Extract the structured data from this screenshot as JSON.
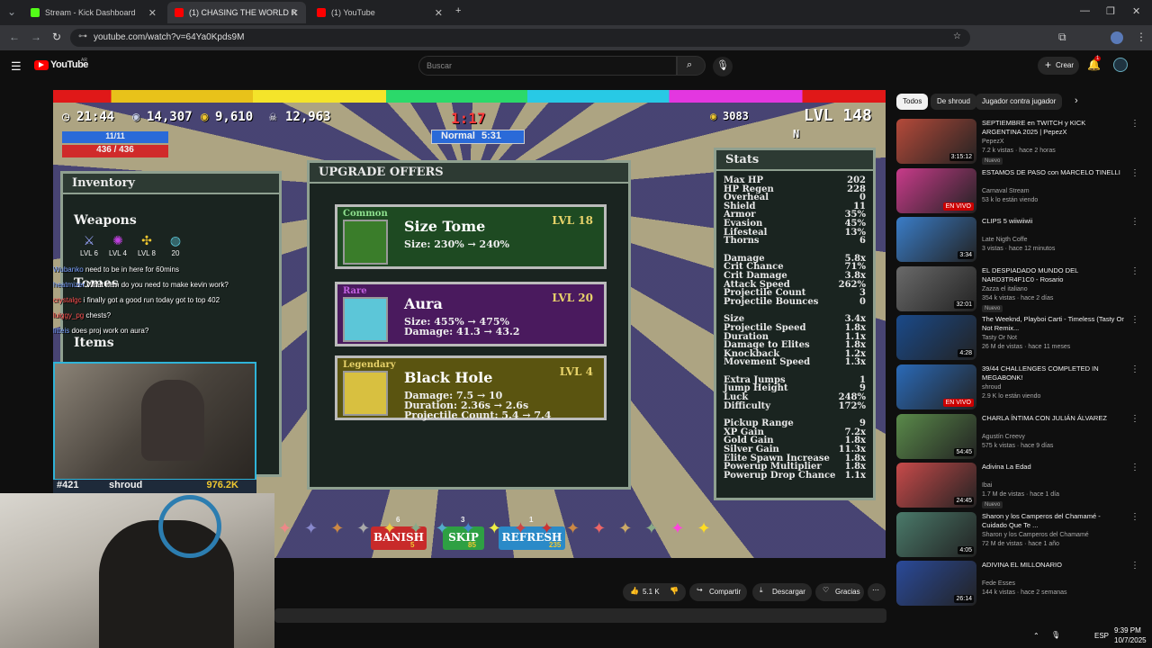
{
  "browser": {
    "tabs": [
      {
        "title": "Stream - Kick Dashboard",
        "color": "#53fc18"
      },
      {
        "title": "(1) CHASING THE WORLD R",
        "color": "#ff0000"
      },
      {
        "title": "(1) YouTube",
        "color": "#ff0000"
      }
    ],
    "url": "youtube.com/watch?v=64Ya0Kpds9M"
  },
  "youtube": {
    "logo": "YouTube",
    "region": "AR",
    "search_placeholder": "Buscar",
    "create_label": "Crear",
    "notif_count": "1"
  },
  "game": {
    "timer": "21:44",
    "silver": "14,307",
    "gold": "9,610",
    "kills": "12,963",
    "countdown": "1:17",
    "difficulty": "Normal",
    "difficulty_value": "5:31",
    "coins": "3083",
    "level": "LVL 148",
    "hp_fraction": "11/11",
    "hp": "436 / 436",
    "inventory_title": "Inventory",
    "weapons_title": "Weapons",
    "weapon_levels": [
      "LVL 6",
      "LVL 4",
      "LVL 8",
      "20"
    ],
    "tomes_title": "Tomes",
    "items_title": "Items",
    "upgrade_title": "UPGRADE OFFERS",
    "offers": [
      {
        "rarity": "Common",
        "name": "Size Tome",
        "level": "LVL 18",
        "lines": [
          "Size: 230% → 240%"
        ],
        "bg": "#1e4a22",
        "icon": "#3a7d2a",
        "rarity_color": "#8fe08f"
      },
      {
        "rarity": "Rare",
        "name": "Aura",
        "level": "LVL 20",
        "lines": [
          "Size: 455% → 475%",
          "Damage: 41.3 → 43.2"
        ],
        "bg": "#4a1a5e",
        "icon": "#5cc6d8",
        "rarity_color": "#c060e0"
      },
      {
        "rarity": "Legendary",
        "name": "Black Hole",
        "level": "LVL 4",
        "lines": [
          "Damage: 7.5 → 10",
          "Duration: 2.36s → 2.6s",
          "Projectile Count: 5.4 → 7.4"
        ],
        "bg": "#5a5410",
        "icon": "#d8c040",
        "rarity_color": "#e8d36a"
      }
    ],
    "buttons": [
      {
        "label": "BANISH",
        "count": "6",
        "cost": "5",
        "color": "#c82a2a"
      },
      {
        "label": "SKIP",
        "count": "3",
        "cost": "85",
        "color": "#2ea043"
      },
      {
        "label": "REFRESH",
        "count": "1",
        "cost": "235",
        "color": "#2a8ac8"
      }
    ],
    "stats_title": "Stats",
    "stats": [
      [
        "Max HP",
        "202"
      ],
      [
        "HP Regen",
        "228"
      ],
      [
        "Overheal",
        "0"
      ],
      [
        "Shield",
        "11"
      ],
      [
        "Armor",
        "35%"
      ],
      [
        "Evasion",
        "45%"
      ],
      [
        "Lifesteal",
        "13%"
      ],
      [
        "Thorns",
        "6"
      ],
      [
        "",
        ""
      ],
      [
        "Damage",
        "5.8x"
      ],
      [
        "Crit Chance",
        "71%"
      ],
      [
        "Crit Damage",
        "3.8x"
      ],
      [
        "Attack Speed",
        "262%"
      ],
      [
        "Projectile Count",
        "3"
      ],
      [
        "Projectile Bounces",
        "0"
      ],
      [
        "",
        ""
      ],
      [
        "Size",
        "3.4x"
      ],
      [
        "Projectile Speed",
        "1.8x"
      ],
      [
        "Duration",
        "1.1x"
      ],
      [
        "Damage to Elites",
        "1.8x"
      ],
      [
        "Knockback",
        "1.2x"
      ],
      [
        "Movement Speed",
        "1.3x"
      ],
      [
        "",
        ""
      ],
      [
        "Extra Jumps",
        "1"
      ],
      [
        "Jump Height",
        "9"
      ],
      [
        "Luck",
        "248%"
      ],
      [
        "Difficulty",
        "172%"
      ],
      [
        "",
        ""
      ],
      [
        "Pickup Range",
        "9"
      ],
      [
        "XP Gain",
        "7.2x"
      ],
      [
        "Gold Gain",
        "1.8x"
      ],
      [
        "Silver Gain",
        "11.3x"
      ],
      [
        "Elite Spawn Increase",
        "1.8x"
      ],
      [
        "Powerup Multiplier",
        "1.8x"
      ],
      [
        "Powerup Drop Chance",
        "1.1x"
      ]
    ],
    "compass": "N"
  },
  "chat": [
    {
      "user": "Wubanko",
      "text": "need to be in here for 60mins",
      "color": "#7aa0ff"
    },
    {
      "user": "heatmizer",
      "text": "What item do you need to make kevin work?",
      "color": "#7aa0ff"
    },
    {
      "user": "crystalgc",
      "text": "i finally got a good run today got to top 402",
      "color": "#ff5050"
    },
    {
      "user": "luiggy_pg",
      "text": "chests?",
      "color": "#ff5050"
    },
    {
      "user": "litteis",
      "text": "does proj work on aura?",
      "color": "#7aa0ff"
    }
  ],
  "streamer": {
    "rank": "#421",
    "name": "shroud",
    "score": "976.2K"
  },
  "actions": {
    "likes": "5.1 K",
    "share": "Compartir",
    "download": "Descargar",
    "thanks": "Gracias"
  },
  "chips": [
    "Todos",
    "De shroud",
    "Jugador contra jugador"
  ],
  "recommendations": [
    {
      "title": "SEPTIEMBRE en TWITCH y KICK ARGENTINA 2025 | PepezX",
      "channel": "PepezX",
      "meta": "7.2 k vistas · hace 2 horas",
      "badge": "Nuevo",
      "duration": "3:15:12",
      "color": "#b54a3a"
    },
    {
      "title": "ESTAMOS DE PASO con MARCELO TINELLI",
      "channel": "Carnaval Stream",
      "meta": "53 k lo están viendo",
      "badge": "",
      "duration": "EN VIVO",
      "color": "#c83b8a"
    },
    {
      "title": "CLIPS 5 wiiwiiwii",
      "channel": "Late Nigth Coffe",
      "meta": "3 vistas · hace 12 minutos",
      "badge": "",
      "duration": "3:34",
      "color": "#3a7dc8"
    },
    {
      "title": "EL DESPIADADO MUNDO DEL NARD3TR4F1C0 - Rosario",
      "channel": "Zazza el italiano",
      "meta": "354 k vistas · hace 2 días",
      "badge": "Nuevo",
      "duration": "32:01",
      "color": "#6a6a6a"
    },
    {
      "title": "The Weeknd, Playboi Carti - Timeless (Tasty Or Not Remix...",
      "channel": "Tasty Or Not",
      "meta": "26 M de vistas · hace 11 meses",
      "badge": "",
      "duration": "4:28",
      "color": "#1a4a8a"
    },
    {
      "title": "39/44 CHALLENGES COMPLETED IN MEGABONK!",
      "channel": "shroud",
      "meta": "2.9 K lo están viendo",
      "badge": "",
      "duration": "EN VIVO",
      "color": "#2a6ab8"
    },
    {
      "title": "CHARLA ÍNTIMA CON JULIÁN ÁLVAREZ",
      "channel": "Agustín Creevy",
      "meta": "575 k vistas · hace 9 días",
      "badge": "",
      "duration": "54:45",
      "color": "#5a8a4a"
    },
    {
      "title": "Adivina La Edad",
      "channel": "Ibai",
      "meta": "1.7 M de vistas · hace 1 día",
      "badge": "Nuevo",
      "duration": "24:45",
      "color": "#c84a4a"
    },
    {
      "title": "Sharon y los Camperos del Chamamé - Cuidado Que Te ...",
      "channel": "Sharon y los Camperos del Chamamé",
      "meta": "72 M de vistas · hace 1 año",
      "badge": "",
      "duration": "4:05",
      "color": "#4a7a6a"
    },
    {
      "title": "ADIVINA EL MILLONARIO",
      "channel": "Fede Esses",
      "meta": "144 k vistas · hace 2 semanas",
      "badge": "",
      "duration": "26:14",
      "color": "#2a4a9a"
    }
  ],
  "system": {
    "time": "9:39 PM",
    "date": "10/7/2025",
    "lang": "ESP"
  }
}
